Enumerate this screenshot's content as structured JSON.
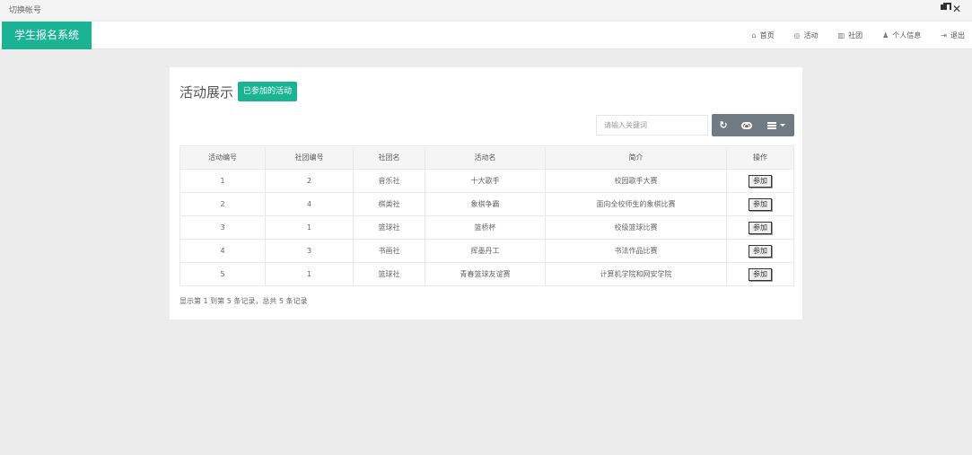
{
  "window": {
    "title": "切换帐号"
  },
  "nav": {
    "brand": "学生报名系统",
    "links": [
      {
        "icon": "home-icon",
        "glyph": "⌂",
        "label": "首页"
      },
      {
        "icon": "activity-icon",
        "glyph": "◎",
        "label": "活动"
      },
      {
        "icon": "chart-icon",
        "glyph": "▥",
        "label": "社团"
      },
      {
        "icon": "user-icon",
        "glyph": "♟",
        "label": "个人信息"
      },
      {
        "icon": "logout-icon",
        "glyph": "⇥",
        "label": "退出"
      }
    ]
  },
  "main": {
    "title": "活动展示",
    "joined_button": "已参加的活动",
    "search_placeholder": "请输入关键词",
    "table": {
      "headers": [
        "活动编号",
        "社团编号",
        "社团名",
        "活动名",
        "简介",
        "操作"
      ],
      "rows": [
        {
          "activity_id": "1",
          "club_id": "2",
          "club_name": "音乐社",
          "activity_name": "十大歌手",
          "intro": "校园歌手大赛",
          "action": "参加"
        },
        {
          "activity_id": "2",
          "club_id": "4",
          "club_name": "棋类社",
          "activity_name": "象棋争霸",
          "intro": "面向全校师生的象棋比赛",
          "action": "参加"
        },
        {
          "activity_id": "3",
          "club_id": "1",
          "club_name": "篮球社",
          "activity_name": "篮桥杯",
          "intro": "校级篮球比赛",
          "action": "参加"
        },
        {
          "activity_id": "4",
          "club_id": "3",
          "club_name": "书画社",
          "activity_name": "挥墨丹工",
          "intro": "书法作品比赛",
          "action": "参加"
        },
        {
          "activity_id": "5",
          "club_id": "1",
          "club_name": "篮球社",
          "activity_name": "青春篮球友谊赛",
          "intro": "计算机学院和网安学院",
          "action": "参加"
        }
      ]
    },
    "summary": "显示第 1 到第 5 条记录，总共 5 条记录"
  }
}
